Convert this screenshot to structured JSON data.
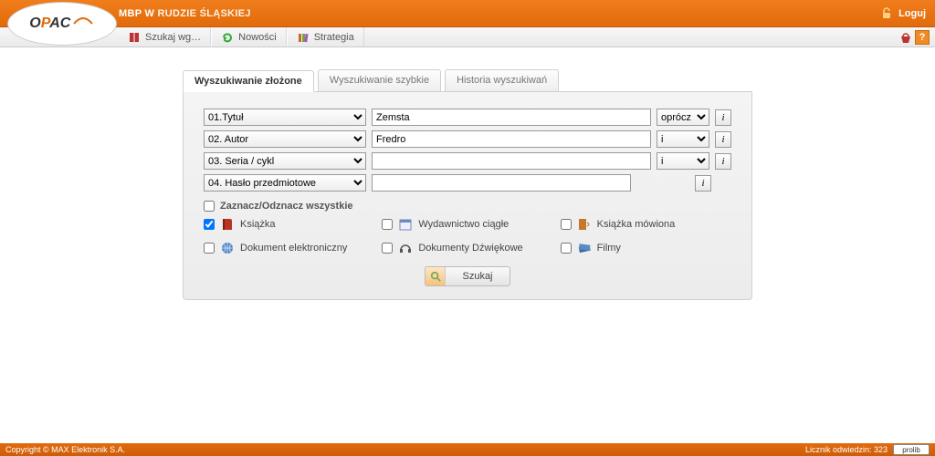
{
  "header": {
    "library_prefix": "MBP W",
    "library_city": "RUDZIE ŚLĄSKIEJ",
    "login": "Loguj"
  },
  "logo": {
    "text_pre": "O",
    "text_mid": "P",
    "text_post": "AC"
  },
  "toolbar": {
    "items": [
      {
        "label": "Szukaj wg…"
      },
      {
        "label": "Nowości"
      },
      {
        "label": "Strategia"
      }
    ],
    "help_char": "?"
  },
  "tabs": [
    {
      "label": "Wyszukiwanie złożone",
      "active": true
    },
    {
      "label": "Wyszukiwanie szybkie",
      "active": false
    },
    {
      "label": "Historia wyszukiwań",
      "active": false
    }
  ],
  "rows": [
    {
      "field": "01.Tytuł",
      "value": "Zemsta",
      "op": "oprócz",
      "has_op": true
    },
    {
      "field": "02. Autor",
      "value": "Fredro",
      "op": "i",
      "has_op": true
    },
    {
      "field": "03. Seria / cykl",
      "value": "",
      "op": "i",
      "has_op": true
    },
    {
      "field": "04. Hasło przedmiotowe",
      "value": "",
      "op": "",
      "has_op": false
    }
  ],
  "info_char": "i",
  "check_all": {
    "label": "Zaznacz/Odznacz wszystkie",
    "checked": false
  },
  "doctypes": [
    {
      "label": "Książka",
      "checked": true
    },
    {
      "label": "Wydawnictwo ciągłe",
      "checked": false
    },
    {
      "label": "Książka mówiona",
      "checked": false
    },
    {
      "label": "Dokument elektroniczny",
      "checked": false
    },
    {
      "label": "Dokumenty Dźwiękowe",
      "checked": false
    },
    {
      "label": "Filmy",
      "checked": false
    }
  ],
  "search_button": "Szukaj",
  "footer": {
    "copyright": "Copyright © MAX Elektronik S.A.",
    "visits": "Licznik odwiedzin: 323",
    "prolib": "prolib"
  }
}
